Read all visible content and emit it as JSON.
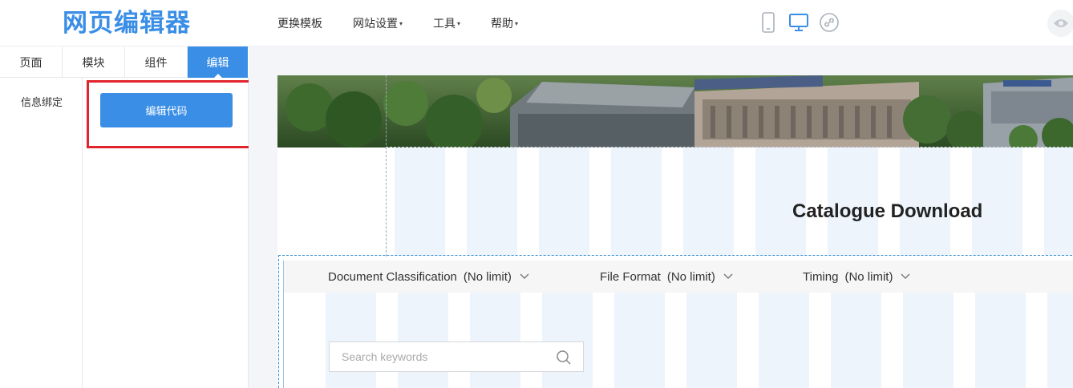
{
  "app": {
    "logo_text": "网页编辑器"
  },
  "nav": {
    "items": [
      {
        "label": "更换模板",
        "has_caret": false
      },
      {
        "label": "网站设置",
        "has_caret": true
      },
      {
        "label": "工具",
        "has_caret": true
      },
      {
        "label": "帮助",
        "has_caret": true
      }
    ],
    "caret": "▾"
  },
  "devices": {
    "items": [
      "mobile-icon",
      "desktop-icon",
      "link-icon"
    ],
    "active": "desktop-icon",
    "accent": "#3a8ee6"
  },
  "left_tabs": [
    {
      "label": "页面",
      "active": false
    },
    {
      "label": "模块",
      "active": false
    },
    {
      "label": "组件",
      "active": false
    },
    {
      "label": "编辑",
      "active": true
    }
  ],
  "left_panel": {
    "subnav_label": "信息绑定",
    "edit_code_button": "编辑代码"
  },
  "canvas": {
    "section_title": "Catalogue Download",
    "filters": [
      {
        "label": "Document Classification",
        "value": "(No limit)"
      },
      {
        "label": "File Format",
        "value": "(No limit)"
      },
      {
        "label": "Timing",
        "value": "(No limit)"
      }
    ],
    "search": {
      "placeholder": "Search keywords"
    }
  },
  "colors": {
    "brand_blue": "#3a8ee6",
    "highlight_red": "#e0232d",
    "column_stripe": "#edf4fc"
  }
}
